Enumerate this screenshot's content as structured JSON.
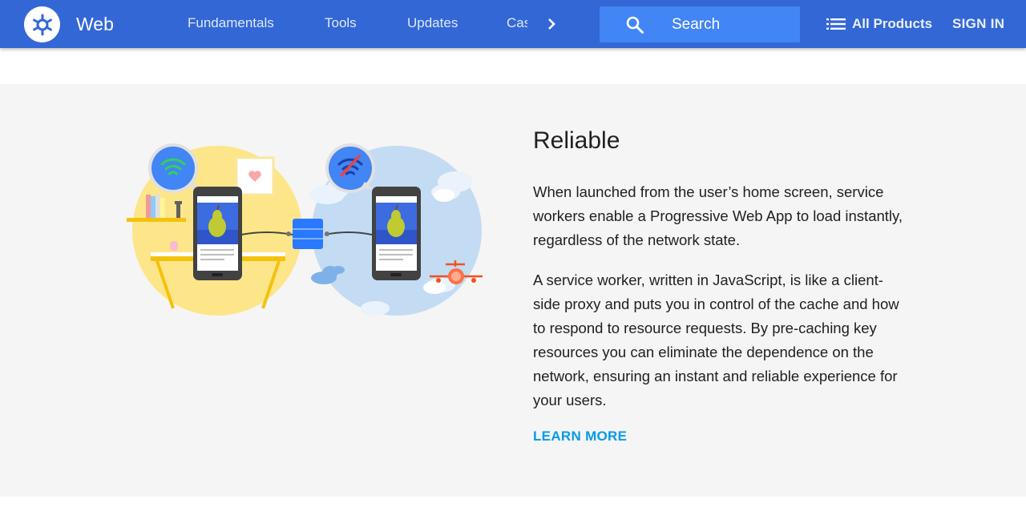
{
  "header": {
    "brand": "Web",
    "nav": [
      "Fundamentals",
      "Tools",
      "Updates",
      "Cas"
    ],
    "search_placeholder": "Search",
    "all_products": "All Products",
    "sign_in": "SIGN IN"
  },
  "feature": {
    "title": "Reliable",
    "paragraph_1": "When launched from the user’s home screen, service workers enable a Progressive Web App to load instantly, regardless of the network state.",
    "paragraph_2": "A service worker, written in JavaScript, is like a client-side proxy and puts you in control of the cache and how to respond to resource requests. By pre-caching key resources you can eliminate the dependence on the network, ensuring an instant and reliable experience for your users.",
    "learn_more": "LEARN MORE"
  },
  "icons": {
    "logo": "web-logo-icon",
    "nav_next": "chevron-right-icon",
    "search": "search-icon",
    "all_products": "list-icon"
  },
  "colors": {
    "header_bg": "#3367d6",
    "search_bg": "#4285f4",
    "section_bg": "#f5f5f5",
    "link": "#039be5"
  }
}
